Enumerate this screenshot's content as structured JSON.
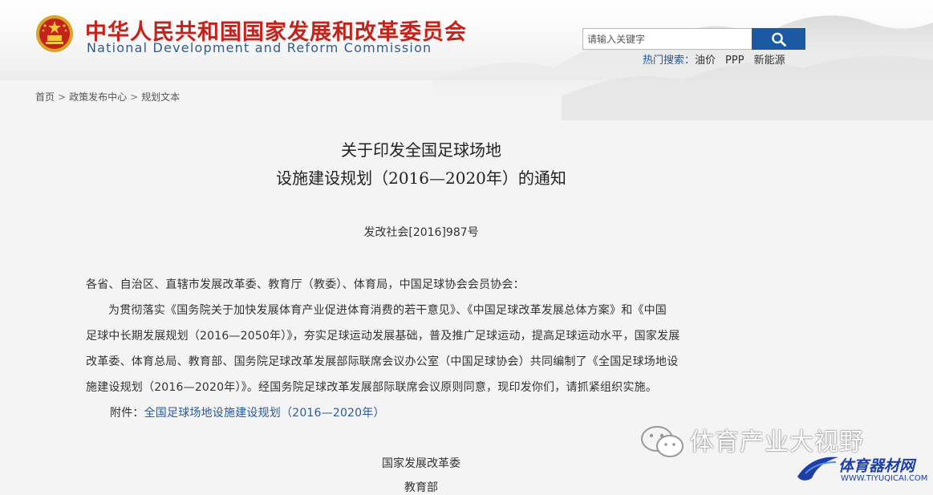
{
  "header": {
    "site_name_cn": "中华人民共和国国家发展和改革委员会",
    "site_name_en": "National Development and Reform Commission",
    "search_placeholder": "请输入关键字",
    "hot_search_label": "热门搜索：",
    "hot_search_items": [
      "油价",
      "PPP",
      "新能源"
    ],
    "colors": {
      "brand_red": "#c4221a",
      "brand_blue": "#1b5aa2"
    }
  },
  "breadcrumb": [
    "首页",
    "政策发布中心",
    "规划文本"
  ],
  "document": {
    "title_line1": "关于印发全国足球场地",
    "title_line2": "设施建设规划（2016—2020年）的通知",
    "doc_number": "发改社会[2016]987号",
    "addressee": "各省、自治区、直辖市发展改革委、教育厅（教委）、体育局，中国足球协会会员协会：",
    "body_lines": [
      "为贯彻落实《国务院关于加快发展体育产业促进体育消费的若干意见》、《中国足球改革发展总体方案》和《中国",
      "足球中长期发展规划（2016—2050年）》，夯实足球运动发展基础，普及推广足球运动，提高足球运动水平，国家发展",
      "改革委、体育总局、教育部、国务院足球改革发展部际联席会议办公室（中国足球协会）共同编制了《全国足球场地设",
      "施建设规划（2016—2020年）》。经国务院足球改革发展部际联席会议原则同意，现印发你们，请抓紧组织实施。"
    ],
    "attachment_label": "附件：",
    "attachment_link": "全国足球场地设施建设规划（2016—2020年）",
    "signatories": [
      "国家发展改革委",
      "教育部"
    ]
  },
  "watermark": {
    "wechat_text": "体育产业大视野",
    "brand": "体育器材网",
    "url": "WWW.TIYUQICAI.COM"
  }
}
